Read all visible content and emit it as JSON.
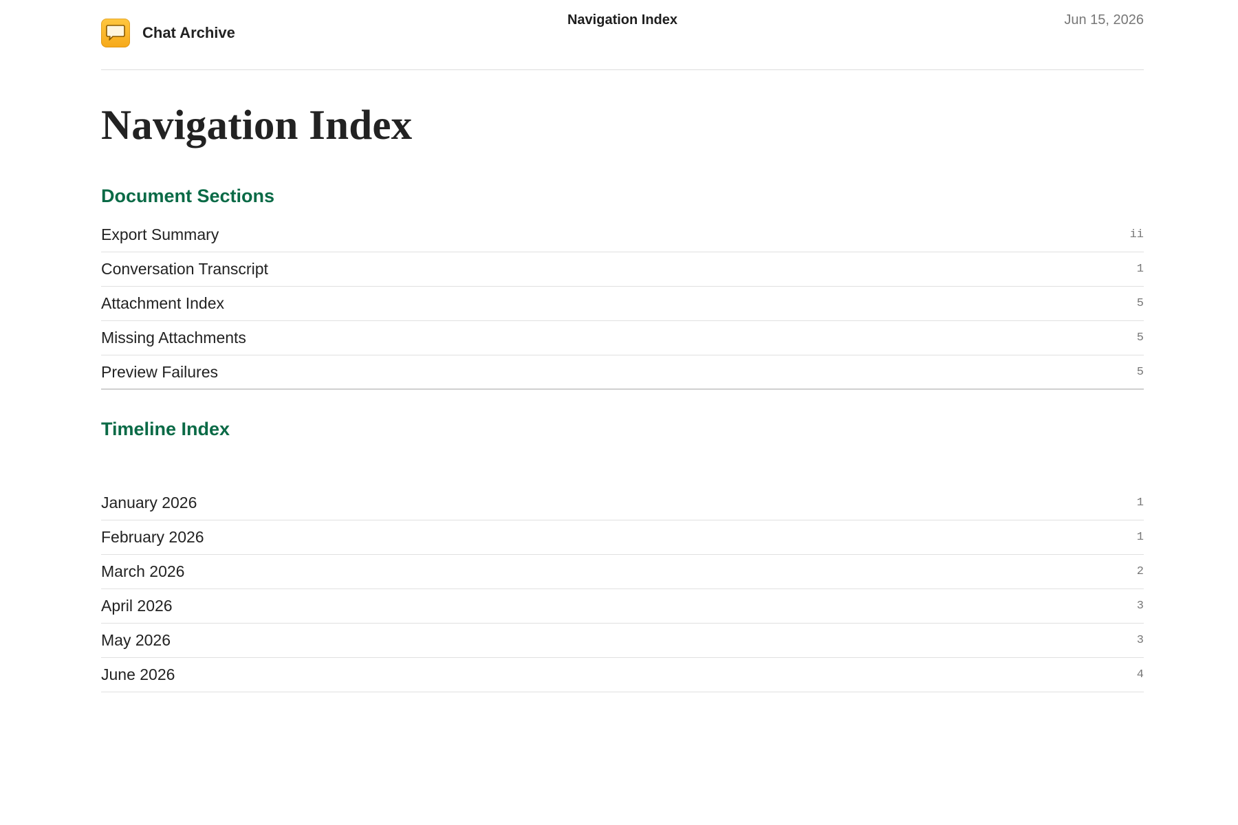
{
  "header": {
    "app_name": "Chat Archive",
    "app_icon": "chat-bubble-icon",
    "title": "Navigation Index",
    "date": "Jun 15, 2026"
  },
  "document": {
    "title": "Navigation Index"
  },
  "document_sections": {
    "heading": "Document Sections",
    "items": [
      {
        "label": "Export Summary",
        "page": "ii"
      },
      {
        "label": "Conversation Transcript",
        "page": "1"
      },
      {
        "label": "Attachment Index",
        "page": "5"
      },
      {
        "label": "Missing Attachments",
        "page": "5"
      },
      {
        "label": "Preview Failures",
        "page": "5"
      }
    ]
  },
  "timeline_index": {
    "heading": "Timeline Index",
    "items": [
      {
        "label": "January 2026",
        "page": "1"
      },
      {
        "label": "February 2026",
        "page": "1"
      },
      {
        "label": "March 2026",
        "page": "2"
      },
      {
        "label": "April 2026",
        "page": "3"
      },
      {
        "label": "May 2026",
        "page": "3"
      },
      {
        "label": "June 2026",
        "page": "4"
      }
    ]
  },
  "colors": {
    "accent": "#0a6a46",
    "icon_fill": "#f6a91a",
    "muted_text": "#777777"
  }
}
